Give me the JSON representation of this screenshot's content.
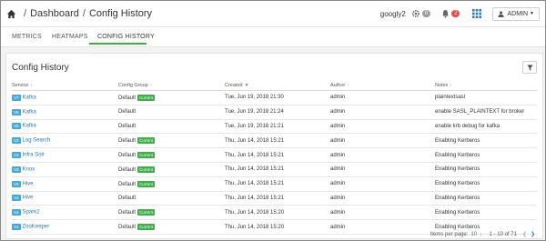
{
  "breadcrumb": {
    "part1": "Dashboard",
    "separator": "/",
    "part2": "Config History"
  },
  "header": {
    "cluster_name": "googly2",
    "ops_count": "0",
    "alerts_count": "2",
    "user_label": "ADMIN"
  },
  "tabs": [
    {
      "label": "METRICS"
    },
    {
      "label": "HEATMAPS"
    },
    {
      "label": "CONFIG HISTORY"
    }
  ],
  "panel": {
    "title": "Config History"
  },
  "table": {
    "headers": [
      "Service",
      "Config Group",
      "Created",
      "Author",
      "Notes"
    ],
    "current_label": "Current",
    "rows": [
      {
        "ver": "V7",
        "service": "Kafka",
        "group": "Default",
        "current": true,
        "created": "Tue, Jun 19, 2018 21:30",
        "author": "admin",
        "notes": "plaintextsasl"
      },
      {
        "ver": "V6",
        "service": "Kafka",
        "group": "Default",
        "current": false,
        "created": "Tue, Jun 19, 2018 21:24",
        "author": "admin",
        "notes": "enable SASL_PLAINTEXT for broker"
      },
      {
        "ver": "V5",
        "service": "Kafka",
        "group": "Default",
        "current": false,
        "created": "Tue, Jun 19, 2018 21:21",
        "author": "admin",
        "notes": "enable krb debug for kafka"
      },
      {
        "ver": "V2",
        "service": "Log Search",
        "group": "Default",
        "current": true,
        "created": "Thu, Jun 14, 2018 15:21",
        "author": "admin",
        "notes": "Enabling Kerberos"
      },
      {
        "ver": "V3",
        "service": "Infra Solr",
        "group": "Default",
        "current": true,
        "created": "Thu, Jun 14, 2018 15:21",
        "author": "admin",
        "notes": "Enabling Kerberos"
      },
      {
        "ver": "V3",
        "service": "Knox",
        "group": "Default",
        "current": true,
        "created": "Thu, Jun 14, 2018 15:21",
        "author": "admin",
        "notes": "Enabling Kerberos"
      },
      {
        "ver": "V5",
        "service": "Hive",
        "group": "Default",
        "current": true,
        "created": "Thu, Jun 14, 2018 15:21",
        "author": "admin",
        "notes": "Enabling Kerberos"
      },
      {
        "ver": "V4",
        "service": "Hive",
        "group": "Default",
        "current": false,
        "created": "Thu, Jun 14, 2018 15:21",
        "author": "admin",
        "notes": "Enabling Kerberos"
      },
      {
        "ver": "V4",
        "service": "Spark2",
        "group": "Default",
        "current": true,
        "created": "Thu, Jun 14, 2018 15:20",
        "author": "admin",
        "notes": "Enabling Kerberos"
      },
      {
        "ver": "V4",
        "service": "ZooKeeper",
        "group": "Default",
        "current": true,
        "created": "Thu, Jun 14, 2018 15:20",
        "author": "admin",
        "notes": "Enabling Kerberos"
      }
    ]
  },
  "pagination": {
    "items_per_page_label": "Items per page:",
    "per_page": "10",
    "range": "1 - 10 of 71"
  },
  "colors": {
    "accent_green": "#3fae49",
    "link_blue": "#2a7ab6",
    "badge_blue": "#4aa8d8",
    "alert_red": "#e04f4f"
  }
}
